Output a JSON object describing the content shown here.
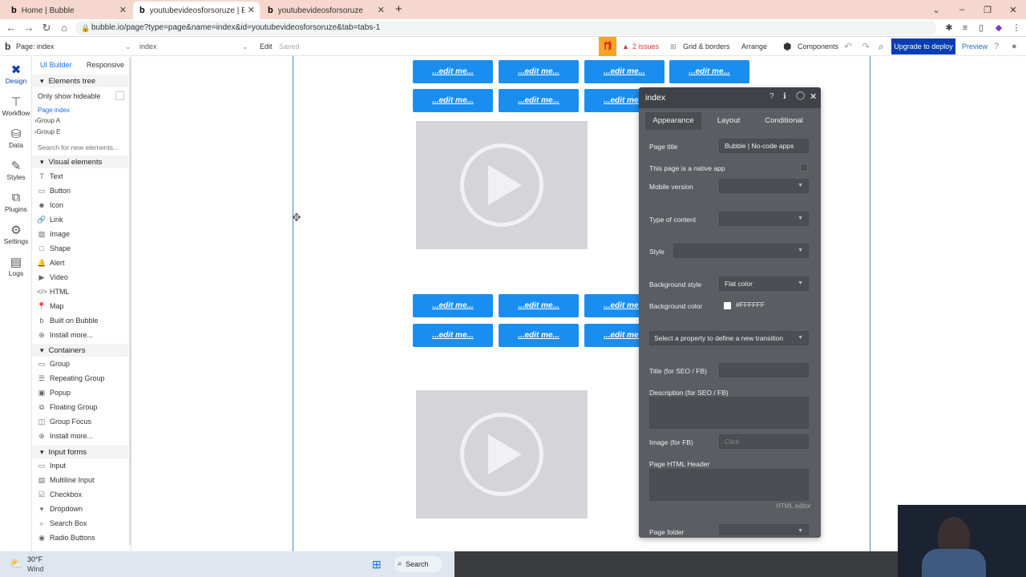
{
  "browser": {
    "tabs": [
      {
        "icon": "b",
        "label": "Home | Bubble",
        "active": false
      },
      {
        "icon": "b",
        "label": "youtubevideosforsoruze | Bubble",
        "active": true
      },
      {
        "icon": "b",
        "label": "youtubevideosforsoruze",
        "active": false
      }
    ],
    "url": "bubble.io/page?type=page&name=index&id=youtubevideosforsoruze&tab=tabs-1"
  },
  "topbar": {
    "page_label": "Page: index",
    "page_select": "index",
    "edit": "Edit",
    "saved": "Saved",
    "issues": "2 issues",
    "grid": "Grid & borders",
    "arrange": "Arrange",
    "components": "Components",
    "upgrade": "Upgrade to deploy",
    "preview": "Preview"
  },
  "rail": [
    {
      "label": "Design",
      "icon": "design-icon",
      "active": true
    },
    {
      "label": "Workflow",
      "icon": "workflow-icon",
      "active": false
    },
    {
      "label": "Data",
      "icon": "data-icon",
      "active": false
    },
    {
      "label": "Styles",
      "icon": "styles-icon",
      "active": false
    },
    {
      "label": "Plugins",
      "icon": "plugins-icon",
      "active": false
    },
    {
      "label": "Settings",
      "icon": "settings-icon",
      "active": false
    },
    {
      "label": "Logs",
      "icon": "logs-icon",
      "active": false
    }
  ],
  "panel": {
    "tab_ui": "UI Builder",
    "tab_responsive": "Responsive",
    "elements_tree": "Elements tree",
    "only_hideable": "Only show hideable",
    "tree": [
      "Page index",
      "Group A",
      "Group E"
    ],
    "search_placeholder": "Search for new elements...",
    "visual_elements": "Visual elements",
    "visual_items": [
      "Text",
      "Button",
      "Icon",
      "Link",
      "Image",
      "Shape",
      "Alert",
      "Video",
      "HTML",
      "Map",
      "Built on Bubble",
      "Install more..."
    ],
    "containers": "Containers",
    "container_items": [
      "Group",
      "Repeating Group",
      "Popup",
      "Floating Group",
      "Group Focus",
      "Install more..."
    ],
    "input_forms": "Input forms",
    "input_items": [
      "Input",
      "Multiline Input",
      "Checkbox",
      "Dropdown",
      "Search Box",
      "Radio Buttons"
    ]
  },
  "canvas": {
    "edit_label": "...edit me..."
  },
  "props": {
    "title": "index",
    "tabs": [
      "Appearance",
      "Layout",
      "Conditional"
    ],
    "page_title_label": "Page title",
    "page_title_value": "Bubble | No-code apps",
    "native_app": "This page is a native app",
    "mobile_version": "Mobile version",
    "type_of_content": "Type of content",
    "style": "Style",
    "bg_style_label": "Background style",
    "bg_style_value": "Flat color",
    "bg_color_label": "Background color",
    "bg_color_value": "#FFFFFF",
    "transition": "Select a property to define a new transition",
    "seo_title": "Title (for SEO / FB)",
    "seo_desc": "Description (for SEO / FB)",
    "image_fb": "Image (for FB)",
    "image_click": "Click",
    "html_header": "Page HTML Header",
    "html_editor": "HTML editor",
    "page_folder": "Page folder"
  },
  "taskbar": {
    "temp": "30°F",
    "weather": "Wind",
    "search": "Search"
  }
}
